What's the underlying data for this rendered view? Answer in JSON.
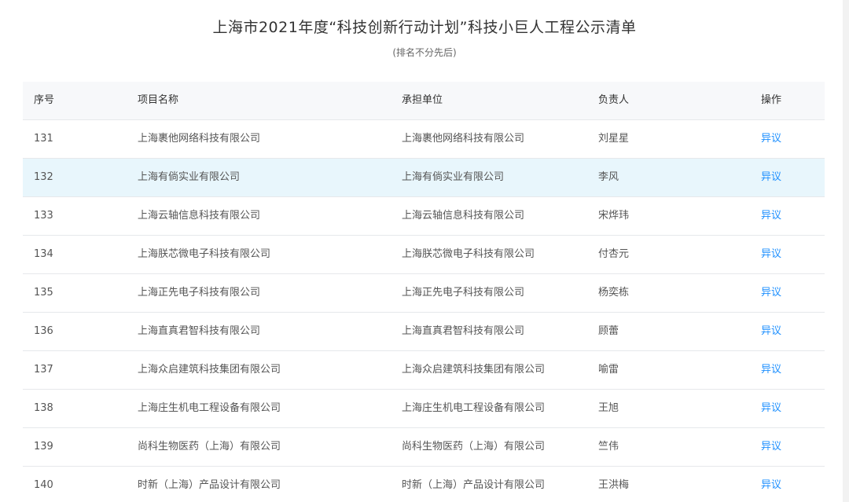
{
  "title": "上海市2021年度“科技创新行动计划”科技小巨人工程公示清单",
  "subtitle": "(排名不分先后)",
  "headers": {
    "no": "序号",
    "name": "项目名称",
    "unit": "承担单位",
    "person": "负责人",
    "action": "操作"
  },
  "rows": [
    {
      "no": "131",
      "name": "上海裹他网络科技有限公司",
      "unit": "上海裹他网络科技有限公司",
      "person": "刘星星",
      "action": "异议"
    },
    {
      "no": "132",
      "name": "上海有倘实业有限公司",
      "unit": "上海有倘实业有限公司",
      "person": "李风",
      "action": "异议"
    },
    {
      "no": "133",
      "name": "上海云轴信息科技有限公司",
      "unit": "上海云轴信息科技有限公司",
      "person": "宋烨玮",
      "action": "异议"
    },
    {
      "no": "134",
      "name": "上海朕芯微电子科技有限公司",
      "unit": "上海朕芯微电子科技有限公司",
      "person": "付杏元",
      "action": "异议"
    },
    {
      "no": "135",
      "name": "上海正先电子科技有限公司",
      "unit": "上海正先电子科技有限公司",
      "person": "杨奕栋",
      "action": "异议"
    },
    {
      "no": "136",
      "name": "上海直真君智科技有限公司",
      "unit": "上海直真君智科技有限公司",
      "person": "顾蕾",
      "action": "异议"
    },
    {
      "no": "137",
      "name": "上海众启建筑科技集团有限公司",
      "unit": "上海众启建筑科技集团有限公司",
      "person": "喻雷",
      "action": "异议"
    },
    {
      "no": "138",
      "name": "上海庄生机电工程设备有限公司",
      "unit": "上海庄生机电工程设备有限公司",
      "person": "王旭",
      "action": "异议"
    },
    {
      "no": "139",
      "name": "尚科生物医药（上海）有限公司",
      "unit": "尚科生物医药（上海）有限公司",
      "person": "竺伟",
      "action": "异议"
    },
    {
      "no": "140",
      "name": "时新（上海）产品设计有限公司",
      "unit": "时新（上海）产品设计有限公司",
      "person": "王洪梅",
      "action": "异议"
    }
  ],
  "colors": {
    "link": "#1e90ff",
    "header_bg": "#f7f8fa",
    "highlight_bg": "#e8f6fc"
  }
}
